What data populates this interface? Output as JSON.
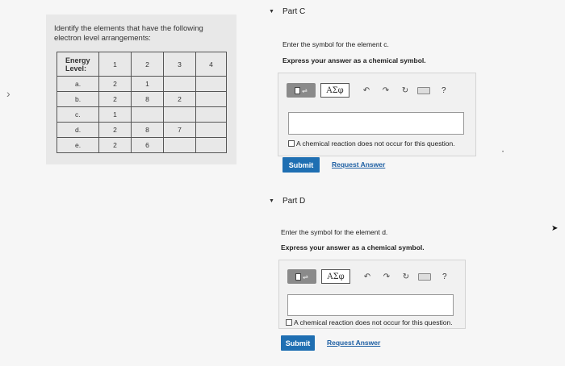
{
  "question": {
    "prompt": "Identify the elements that have the following electron level arrangements:",
    "table": {
      "header": [
        "Energy Level:",
        "1",
        "2",
        "3",
        "4"
      ],
      "rows": [
        {
          "label": "a.",
          "cells": [
            "2",
            "1",
            "",
            ""
          ]
        },
        {
          "label": "b.",
          "cells": [
            "2",
            "8",
            "2",
            ""
          ]
        },
        {
          "label": "c.",
          "cells": [
            "1",
            "",
            "",
            ""
          ]
        },
        {
          "label": "d.",
          "cells": [
            "2",
            "8",
            "7",
            ""
          ]
        },
        {
          "label": "e.",
          "cells": [
            "2",
            "6",
            "",
            ""
          ]
        }
      ]
    }
  },
  "partC": {
    "title": "Part C",
    "instruction": "Enter the symbol for the element c.",
    "format": "Express your answer as a chemical symbol.",
    "greek_label": "ΑΣφ",
    "help_label": "?",
    "input_value": "",
    "checkbox_label": "A chemical reaction does not occur for this question.",
    "submit_label": "Submit",
    "request_label": "Request Answer"
  },
  "partD": {
    "title": "Part D",
    "instruction": "Enter the symbol for the element d.",
    "format": "Express your answer as a chemical symbol.",
    "greek_label": "ΑΣφ",
    "help_label": "?",
    "input_value": "",
    "checkbox_label": "A chemical reaction does not occur for this question.",
    "submit_label": "Submit",
    "request_label": "Request Answer"
  },
  "icons": {
    "collapse": "caret-down-icon",
    "undo": "undo-icon",
    "redo": "redo-icon",
    "reset": "reset-icon",
    "keyboard": "keyboard-icon",
    "help": "help-icon"
  }
}
